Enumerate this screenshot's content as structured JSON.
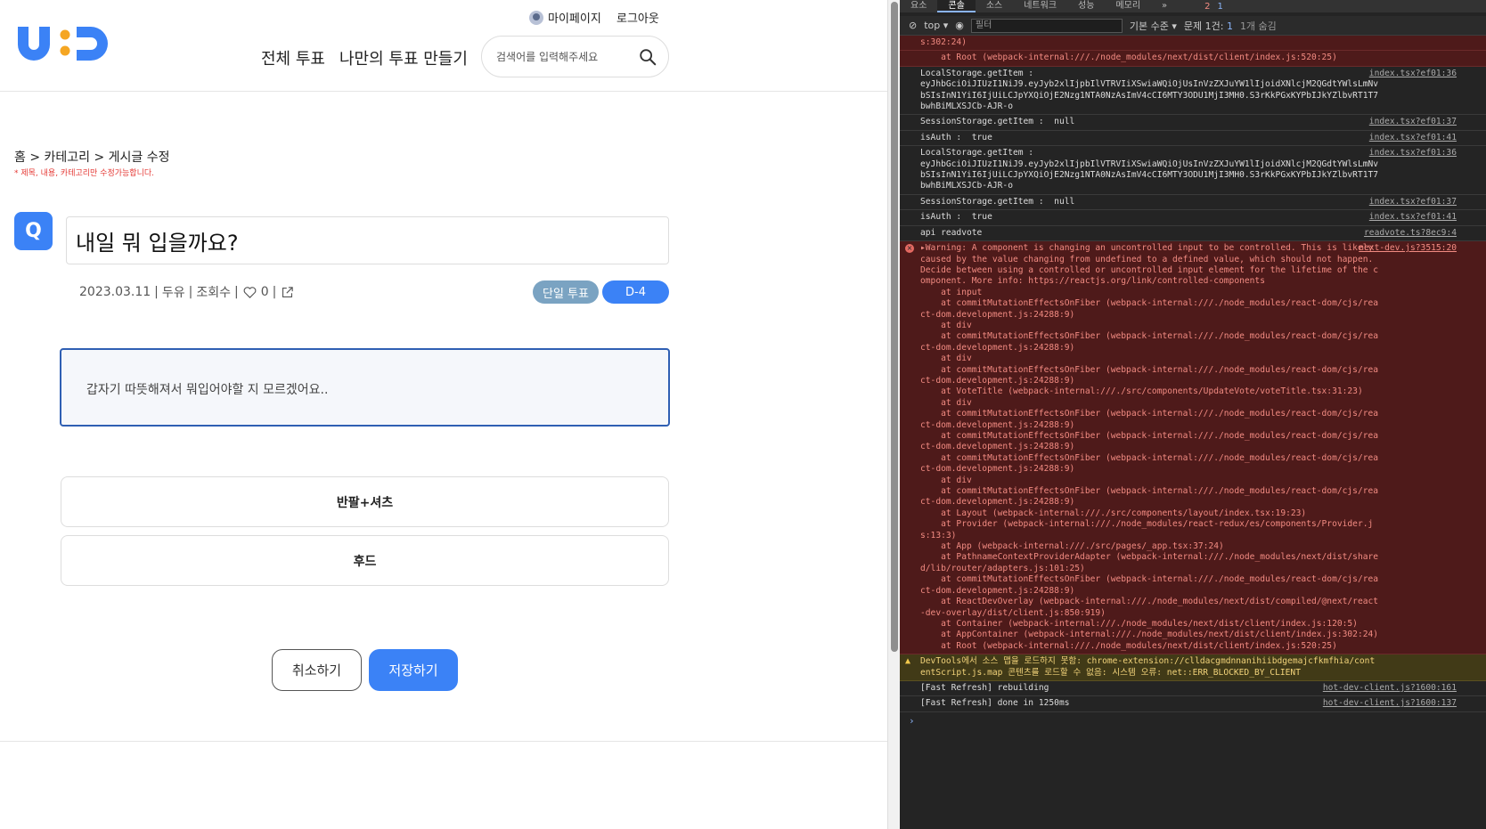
{
  "header": {
    "logo_text": "U:D",
    "mypage_label": "마이페이지",
    "logout_label": "로그아웃",
    "nav_all": "전체 투표",
    "nav_make": "나만의 투표 만들기",
    "search_placeholder": "검색어를 입력해주세요"
  },
  "page": {
    "breadcrumb": "홈 > 카테고리 > 게시글 수정",
    "notice": "* 제목, 내용, 카테고리만 수정가능합니다.",
    "q_badge": "Q",
    "title_value": "내일 뭐 입을까요?",
    "meta": {
      "date": "2023.03.11",
      "author": "두유",
      "views_label": "조회수",
      "likes": "0",
      "sep": "|"
    },
    "vote_type": "단일 투표",
    "dday": "D-4",
    "content": "갑자기 따뜻해져서 뭐입어야할 지 모르겠어요..",
    "options": [
      "반팔+셔츠",
      "후드"
    ],
    "cancel_label": "취소하기",
    "save_label": "저장하기"
  },
  "colors": {
    "accent": "#3b82f6",
    "logo_orange": "#f5a623",
    "pill_gray": "#7aa3c2",
    "notice_red": "#e53935"
  },
  "devtools": {
    "tabs": [
      "요소",
      "콘솔",
      "소스",
      "네트워크",
      "성능",
      "메모리",
      "»"
    ],
    "active_tab": "콘솔",
    "error_count": "2",
    "info_count": "1",
    "context": "top ▾",
    "filter_placeholder": "필터",
    "level": "기본 수준 ▾",
    "issues": "문제 1건: ",
    "issues_count": "1",
    "hidden": "1개 숨김",
    "rows": [
      {
        "type": "err",
        "text": "s:302:24)"
      },
      {
        "type": "err",
        "text": "    at Root (webpack-internal:///./node_modules/next/dist/client/index.js:520:25)"
      },
      {
        "type": "log",
        "text": "LocalStorage.getItem :\neyJhbGciOiJIUzI1NiJ9.eyJyb2xlIjpbIlVTRVIiXSwiaWQiOjUsInVzZXJuYW1lIjoidXNlcjM2QGdtYWlsLmNvbSIsInN1YiI6IjUiLCJpYXQiOjE2Nzg1NTA0NzAsImV4cCI6MTY3ODU1MjI3MH0.S3rKkPGxKYPbIJkYZlbvRT1T7bwhBiMLXSJCb-AJR-o",
        "src": "index.tsx?ef01:36"
      },
      {
        "type": "log",
        "text": "SessionStorage.getItem :  null",
        "src": "index.tsx?ef01:37"
      },
      {
        "type": "log",
        "text": "isAuth :  true",
        "src": "index.tsx?ef01:41"
      },
      {
        "type": "log",
        "text": "LocalStorage.getItem :\neyJhbGciOiJIUzI1NiJ9.eyJyb2xlIjpbIlVTRVIiXSwiaWQiOjUsInVzZXJuYW1lIjoidXNlcjM2QGdtYWlsLmNvbSIsInN1YiI6IjUiLCJpYXQiOjE2Nzg1NTA0NzAsImV4cCI6MTY3ODU1MjI3MH0.S3rKkPGxKYPbIJkYZlbvRT1T7bwhBiMLXSJCb-AJR-o",
        "src": "index.tsx?ef01:36"
      },
      {
        "type": "log",
        "text": "SessionStorage.getItem :  null",
        "src": "index.tsx?ef01:37"
      },
      {
        "type": "log",
        "text": "isAuth :  true",
        "src": "index.tsx?ef01:41"
      },
      {
        "type": "log",
        "text": "api readvote",
        "src": "readvote.ts?8ec9:4"
      },
      {
        "type": "errmain",
        "text": "▸Warning: A component is changing an uncontrolled input to be controlled. This is likely caused by the value changing from undefined to a defined value, which should not happen. Decide between using a controlled or uncontrolled input element for the lifetime of the component. More info: https://reactjs.org/link/controlled-components\n    at input\n    at commitMutationEffectsOnFiber (webpack-internal:///./node_modules/react-dom/cjs/react-dom.development.js:24288:9)\n    at div\n    at commitMutationEffectsOnFiber (webpack-internal:///./node_modules/react-dom/cjs/react-dom.development.js:24288:9)\n    at div\n    at commitMutationEffectsOnFiber (webpack-internal:///./node_modules/react-dom/cjs/react-dom.development.js:24288:9)\n    at VoteTitle (webpack-internal:///./src/components/UpdateVote/voteTitle.tsx:31:23)\n    at div\n    at commitMutationEffectsOnFiber (webpack-internal:///./node_modules/react-dom/cjs/react-dom.development.js:24288:9)\n    at commitMutationEffectsOnFiber (webpack-internal:///./node_modules/react-dom/cjs/react-dom.development.js:24288:9)\n    at commitMutationEffectsOnFiber (webpack-internal:///./node_modules/react-dom/cjs/react-dom.development.js:24288:9)\n    at div\n    at commitMutationEffectsOnFiber (webpack-internal:///./node_modules/react-dom/cjs/react-dom.development.js:24288:9)\n    at Layout (webpack-internal:///./src/components/layout/index.tsx:19:23)\n    at Provider (webpack-internal:///./node_modules/react-redux/es/components/Provider.js:13:3)\n    at App (webpack-internal:///./src/pages/_app.tsx:37:24)\n    at PathnameContextProviderAdapter (webpack-internal:///./node_modules/next/dist/shared/lib/router/adapters.js:101:25)\n    at commitMutationEffectsOnFiber (webpack-internal:///./node_modules/react-dom/cjs/react-dom.development.js:24288:9)\n    at ReactDevOverlay (webpack-internal:///./node_modules/next/dist/compiled/@next/react-dev-overlay/dist/client.js:850:919)\n    at Container (webpack-internal:///./node_modules/next/dist/client/index.js:120:5)\n    at AppContainer (webpack-internal:///./node_modules/next/dist/client/index.js:302:24)\n    at Root (webpack-internal:///./node_modules/next/dist/client/index.js:520:25)",
        "src": "next-dev.js?3515:20"
      },
      {
        "type": "warn",
        "text": "DevTools에서 소스 맵을 로드하지 못함: chrome-extension://clldacgmdnnanihiibdgemajcfkmfhia/contentScript.js.map 콘텐츠를 로드할 수 없음: 시스템 오류: net::ERR_BLOCKED_BY_CLIENT"
      },
      {
        "type": "log",
        "text": "[Fast Refresh] rebuilding",
        "src": "hot-dev-client.js?1600:161"
      },
      {
        "type": "log",
        "text": "[Fast Refresh] done in 1250ms",
        "src": "hot-dev-client.js?1600:137"
      }
    ],
    "prompt": "›"
  }
}
